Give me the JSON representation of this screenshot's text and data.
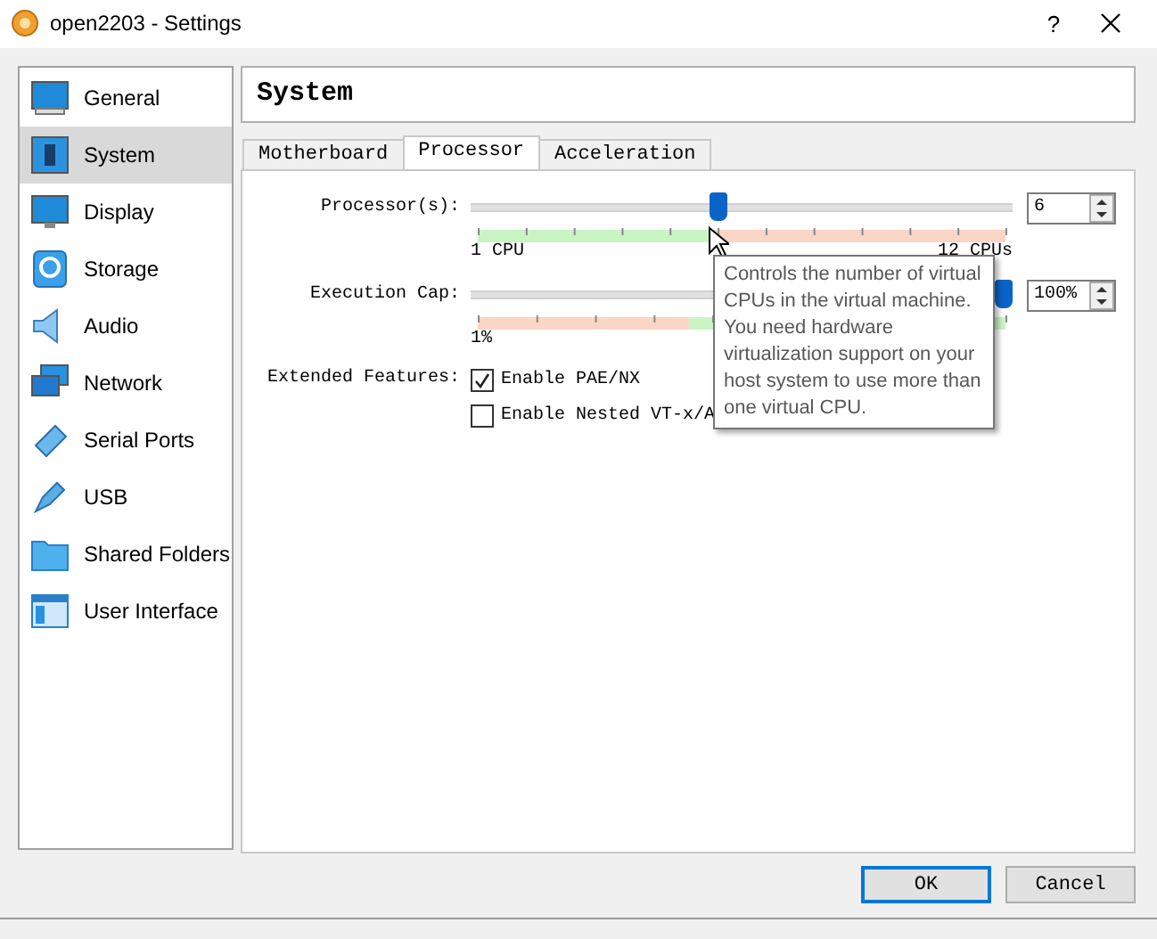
{
  "window": {
    "title": "open2203 - Settings",
    "help": "?"
  },
  "sidebar": {
    "items": [
      {
        "label": "General",
        "selected": false
      },
      {
        "label": "System",
        "selected": true
      },
      {
        "label": "Display",
        "selected": false
      },
      {
        "label": "Storage",
        "selected": false
      },
      {
        "label": "Audio",
        "selected": false
      },
      {
        "label": "Network",
        "selected": false
      },
      {
        "label": "Serial Ports",
        "selected": false
      },
      {
        "label": "USB",
        "selected": false
      },
      {
        "label": "Shared Folders",
        "selected": false
      },
      {
        "label": "User Interface",
        "selected": false
      }
    ]
  },
  "page_title": "System",
  "tabs": [
    {
      "label": "Motherboard",
      "selected": false
    },
    {
      "label": "Processor",
      "selected": true
    },
    {
      "label": "Acceleration",
      "selected": false
    }
  ],
  "processors": {
    "label": "Processor(s):",
    "level": 0.455,
    "min_label": "1 CPU",
    "max_label": "12 CPUs",
    "value": "6"
  },
  "execution_cap": {
    "label": "Execution Cap:",
    "level": 1,
    "min_label": "1%",
    "value": "100%"
  },
  "extended_features": {
    "label": "Extended Features:",
    "options": [
      {
        "label": "Enable PAE/NX",
        "checked": true
      },
      {
        "label": "Enable Nested VT-x/A",
        "checked": false
      }
    ]
  },
  "tooltip": "Controls the number of virtual CPUs in the virtual machine. You need hardware virtualization support on your host system to use more than one virtual CPU.",
  "buttons": [
    {
      "label": "OK",
      "default": true
    },
    {
      "label": "Cancel",
      "default": false
    }
  ]
}
